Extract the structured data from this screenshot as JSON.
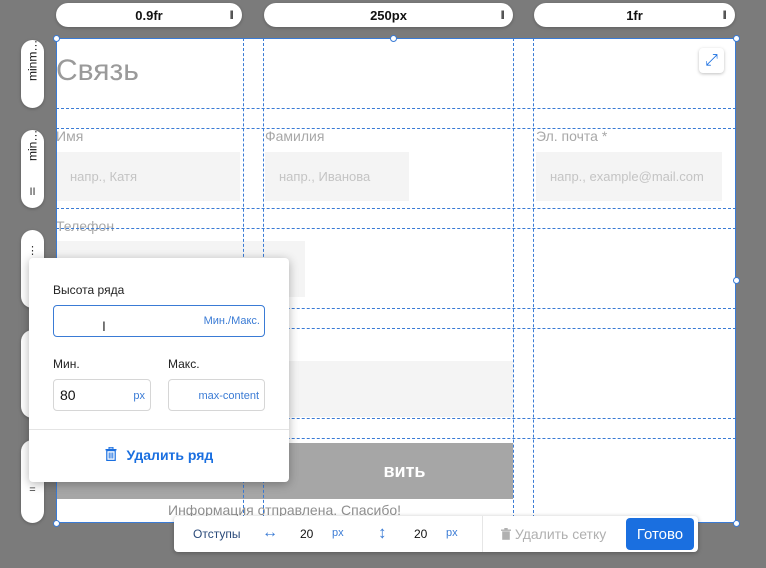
{
  "columns": [
    {
      "label": "0.9fr",
      "grip": "II"
    },
    {
      "label": "250px",
      "grip": "II"
    },
    {
      "label": "1fr",
      "grip": "II"
    }
  ],
  "rows": [
    {
      "label": "minm…",
      "grip": ""
    },
    {
      "label": "min…",
      "grip": "II"
    },
    {
      "label": "⋮",
      "grip": "⋮"
    },
    {
      "label": "",
      "grip": "⋮"
    },
    {
      "label": "",
      "grip": "="
    }
  ],
  "form": {
    "title": "Связь",
    "first_name_label": "Имя",
    "first_name_placeholder": "напр., Катя",
    "last_name_label": "Фамилия",
    "last_name_placeholder": "напр., Иванова",
    "email_label": "Эл. почта *",
    "email_placeholder": "напр., example@mail.com",
    "phone_label": "Телефон",
    "submit_label": "вить",
    "success_message": "Информация отправлена. Спасибо!"
  },
  "popup": {
    "title": "Высота ряда",
    "input_hint": "Мин./Макс.",
    "min_label": "Мин.",
    "min_value": "80",
    "min_unit": "px",
    "max_label": "Макс.",
    "max_value": "max-content",
    "delete_label": "Удалить ряд"
  },
  "toolbar": {
    "gaps_label": "Отступы",
    "h_gap_value": "20",
    "h_gap_unit": "px",
    "v_gap_value": "20",
    "v_gap_unit": "px",
    "delete_grid_label": "Удалить сетку",
    "done_label": "Готово"
  },
  "colors": {
    "accent": "#1a6fe0",
    "grid_line": "#3a7bd5",
    "backdrop": "#7b7b7b"
  },
  "icons": {
    "expand": "expand-arrows-icon",
    "trash": "trash-icon",
    "horizontal_gap": "horizontal-arrows-icon",
    "vertical_gap": "vertical-arrows-icon",
    "text_cursor": "text-cursor-icon"
  }
}
